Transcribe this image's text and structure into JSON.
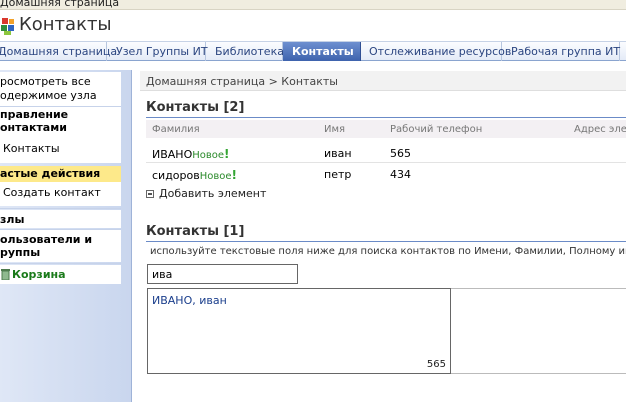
{
  "topbar": {
    "text": "Домашняя страница"
  },
  "site": {
    "title": "Контакты"
  },
  "tabs": [
    {
      "label": "Домашняя страница"
    },
    {
      "label": "Узел Группы ИТ"
    },
    {
      "label": "Библиотека"
    },
    {
      "label": "Контакты"
    },
    {
      "label": "Отслеживание ресурсов"
    },
    {
      "label": "Рабочая группа ИТ"
    }
  ],
  "nav": {
    "view_all_line1": "росмотреть все",
    "view_all_line2": "одержимое узла",
    "manage_line1": "правление",
    "manage_line2": "онтактами",
    "contacts": "Контакты",
    "frequent": "астые действия",
    "create_contact": "Создать контакт",
    "nodes": "злы",
    "users_line1": "ользователи и",
    "users_line2": "руппы",
    "recycle": "Корзина"
  },
  "breadcrumb": "Домашняя страница > Контакты",
  "list": {
    "title": "Контакты [2]",
    "columns": [
      "Фамилия",
      "Имя",
      "Рабочий телефон",
      "Адрес эле"
    ],
    "rows": [
      {
        "last": "ИВАНО",
        "badge": "Новое",
        "first": "иван",
        "phone": "565"
      },
      {
        "last": "сидоров",
        "badge": "Новое",
        "first": "петр",
        "phone": "434"
      }
    ],
    "add_item": "Добавить элемент"
  },
  "search": {
    "title": "Контакты [1]",
    "hint": "используйте текстовые поля ниже для поиска контактов по Имени, Фамилии, Полному имени",
    "value": "ива",
    "result_name": "ИВАНО, иван",
    "result_phone": "565"
  },
  "colors": {
    "tab_active_bg": "#3e63ad",
    "tab_text": "#2b4580",
    "nav_bg": "#c9d6ee",
    "highlight": "#fde98a",
    "rule": "#6b8bc7",
    "recycle_text": "#1a7a1a"
  }
}
